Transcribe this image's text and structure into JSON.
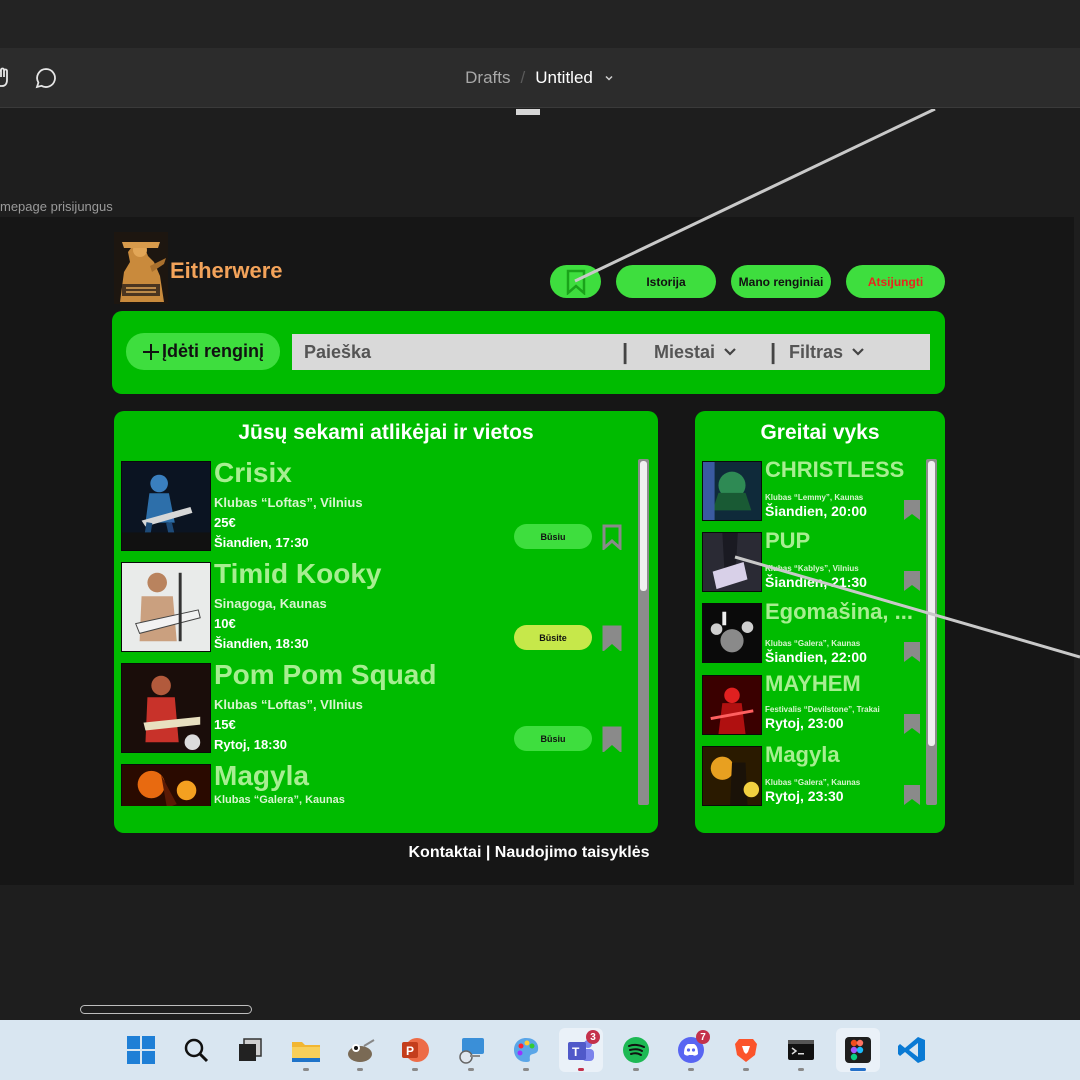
{
  "figma": {
    "breadcrumb_drafts": "Drafts",
    "breadcrumb_sep": "/",
    "file_title": "Untitled",
    "frame_label": "mepage prisijungus"
  },
  "site": {
    "name": "Eitherwere",
    "nav": {
      "bookmark_icon": "bookmark-icon",
      "history": "Istorija",
      "my_events": "Mano renginiai",
      "logout": "Atsijungti"
    },
    "add_event": "Įdėti renginį",
    "search": {
      "placeholder": "Paieška",
      "sep": "|",
      "cities": "Miestai",
      "filter": "Filtras"
    },
    "followed": {
      "title": "Jūsų sekami atlikėjai ir vietos",
      "items": [
        {
          "name": "Crisix",
          "venue": "Klubas “Loftas”, Vilnius",
          "price": "25€",
          "time": "Šiandien, 17:30",
          "button": "Būsiu",
          "selected": false
        },
        {
          "name": "Timid Kooky",
          "venue": "Sinagoga, Kaunas",
          "price": "10€",
          "time": "Šiandien, 18:30",
          "button": "Būsite",
          "selected": true
        },
        {
          "name": "Pom Pom Squad",
          "venue": "Klubas “Loftas”, VIlnius",
          "price": "15€",
          "time": "Rytoj, 18:30",
          "button": "Būsiu",
          "selected": false
        },
        {
          "name": "Magyla",
          "venue": "Klubas “Galera”, Kaunas",
          "price": "",
          "time": "",
          "button": "",
          "selected": false
        }
      ]
    },
    "soon": {
      "title": "Greitai vyks",
      "items": [
        {
          "name": "CHRISTLESS",
          "venue": "Klubas “Lemmy”, Kaunas",
          "time": "Šiandien, 20:00"
        },
        {
          "name": "PUP",
          "venue": "Klubas “Kablys”, Vilnius",
          "time": "Šiandien, 21:30"
        },
        {
          "name": "Egomašina, ...",
          "venue": "Klubas “Galera”, Kaunas",
          "time": "Šiandien, 22:00"
        },
        {
          "name": "MAYHEM",
          "venue": "Festivalis “Devilstone”, Trakai",
          "time": "Rytoj, 23:00"
        },
        {
          "name": "Magyla",
          "venue": "Klubas “Galera”, Kaunas",
          "time": "Rytoj, 23:30"
        }
      ]
    },
    "footer": "Kontaktai | Naudojimo taisyklės"
  },
  "taskbar": {
    "apps": [
      {
        "name": "start-icon"
      },
      {
        "name": "search-icon"
      },
      {
        "name": "task-view-icon"
      },
      {
        "name": "file-explorer-icon"
      },
      {
        "name": "gimp-icon"
      },
      {
        "name": "powerpoint-icon"
      },
      {
        "name": "remote-desktop-icon"
      },
      {
        "name": "paint-icon"
      },
      {
        "name": "teams-icon",
        "badge": "3"
      },
      {
        "name": "spotify-icon"
      },
      {
        "name": "discord-icon",
        "badge": "7"
      },
      {
        "name": "brave-icon"
      },
      {
        "name": "terminal-icon"
      },
      {
        "name": "figma-icon",
        "active": true
      },
      {
        "name": "vscode-icon"
      }
    ]
  },
  "colors": {
    "panel_green": "#00bb00",
    "button_green": "#3ede3e",
    "logo_orange": "#f3a35a",
    "logout_red": "#e8261e",
    "name_green": "#a7ee91"
  }
}
